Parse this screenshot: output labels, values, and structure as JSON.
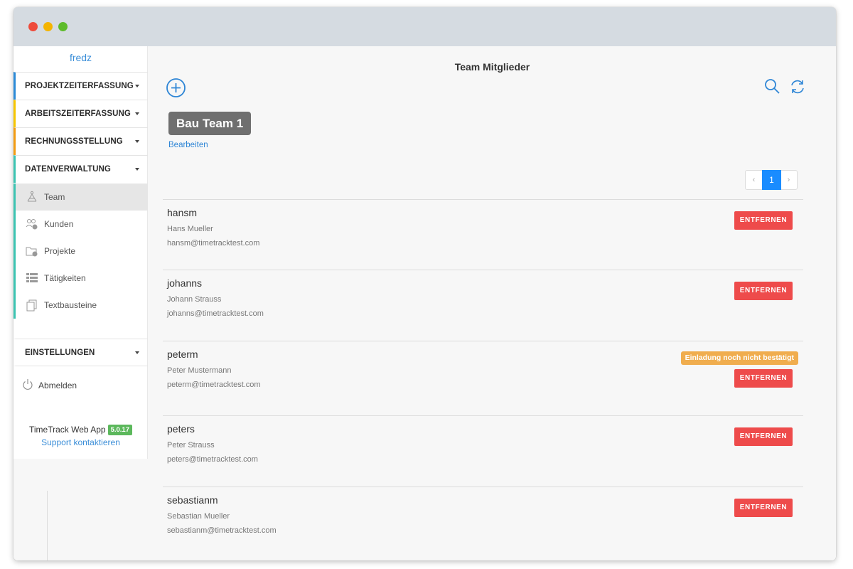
{
  "sidebar": {
    "user": "fredz",
    "sections": [
      {
        "label": "PROJEKTZEITERFASSUNG",
        "color": "#2b8ad8"
      },
      {
        "label": "ARBEITSZEITERFASSUNG",
        "color": "#f7c600"
      },
      {
        "label": "RECHNUNGSSTELLUNG",
        "color": "#f39c12"
      },
      {
        "label": "DATENVERWALTUNG",
        "color": "#3cc4b2"
      }
    ],
    "sub_items": [
      {
        "label": "Team",
        "icon": "team-icon",
        "active": true
      },
      {
        "label": "Kunden",
        "icon": "customers-icon"
      },
      {
        "label": "Projekte",
        "icon": "projects-icon"
      },
      {
        "label": "Tätigkeiten",
        "icon": "activities-icon"
      },
      {
        "label": "Textbausteine",
        "icon": "text-blocks-icon"
      }
    ],
    "settings": "EINSTELLUNGEN",
    "logout": "Abmelden",
    "app_name": "TimeTrack Web App",
    "version": "5.0.17",
    "support": "Support kontaktieren"
  },
  "main": {
    "title": "Team Mitglieder",
    "team_name": "Bau Team 1",
    "edit_link": "Bearbeiten",
    "pagination": {
      "prev": "‹",
      "current": "1",
      "next": "›"
    },
    "remove_label": "ENTFERNEN",
    "members": [
      {
        "username": "hansm",
        "name": "Hans Mueller",
        "email": "hansm@timetracktest.com"
      },
      {
        "username": "johanns",
        "name": "Johann Strauss",
        "email": "johanns@timetracktest.com"
      },
      {
        "username": "peterm",
        "name": "Peter Mustermann",
        "email": "peterm@timetracktest.com",
        "status": "Einladung noch nicht bestätigt"
      },
      {
        "username": "peters",
        "name": "Peter Strauss",
        "email": "peters@timetracktest.com"
      },
      {
        "username": "sebastianm",
        "name": "Sebastian Mueller",
        "email": "sebastianm@timetracktest.com"
      }
    ]
  },
  "colors": {
    "accent": "#2f86d6",
    "danger": "#ee4b4b",
    "warning": "#f0ad4e",
    "success": "#5cb85c"
  }
}
